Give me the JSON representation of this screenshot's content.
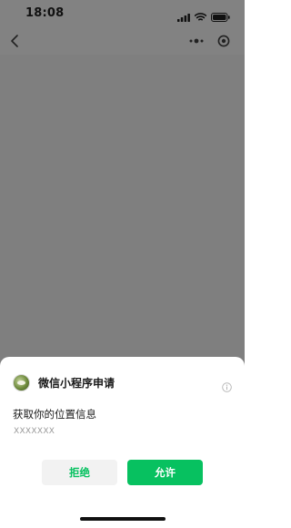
{
  "status_bar": {
    "time": "18:08",
    "icons": [
      "cellular-signal-icon",
      "wifi-icon",
      "battery-icon"
    ]
  },
  "nav_bar": {
    "back_icon": "chevron-left-icon",
    "more_icon": "more-dots-icon",
    "close_icon": "target-circle-icon"
  },
  "permission_sheet": {
    "app_name": "微信小程序申请",
    "info_icon": "info-circle-icon",
    "request_title": "获取你的位置信息",
    "request_description": "XXXXXXX",
    "reject_label": "拒绝",
    "allow_label": "允许"
  },
  "colors": {
    "overlay": "#7f7f7f",
    "sheet_background": "#ffffff",
    "accent_green": "#07c160",
    "reject_background": "#f2f2f2"
  }
}
